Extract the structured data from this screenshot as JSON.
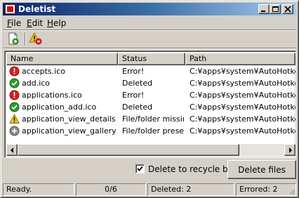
{
  "window": {
    "title": "Deletist",
    "minimize_icon": "minimize-icon",
    "maximize_icon": "maximize-icon",
    "close_icon": "close-icon"
  },
  "menu": [
    {
      "label": "File",
      "accel": "F",
      "rest": "ile"
    },
    {
      "label": "Edit",
      "accel": "E",
      "rest": "dit"
    },
    {
      "label": "Help",
      "accel": "H",
      "rest": "elp"
    }
  ],
  "toolbar": {
    "items": [
      {
        "icon": "new-list-icon"
      },
      {
        "icon": "warning-error-icon"
      }
    ]
  },
  "list": {
    "columns": [
      "Name",
      "Status",
      "Path"
    ],
    "rows": [
      {
        "icon": "error-icon",
        "name": "accepts.ico",
        "status": "Error!",
        "path": "C:¥apps¥system¥AutoHotkey¥S"
      },
      {
        "icon": "success-check-icon",
        "name": "add.ico",
        "status": "Deleted",
        "path": "C:¥apps¥system¥AutoHotkey¥S"
      },
      {
        "icon": "error-icon",
        "name": "applications.ico",
        "status": "Error!",
        "path": "C:¥apps¥system¥AutoHotkey¥S"
      },
      {
        "icon": "success-check-icon",
        "name": "application_add.ico",
        "status": "Deleted",
        "path": "C:¥apps¥system¥AutoHotkey¥S"
      },
      {
        "icon": "warning-icon",
        "name": "application_view_details.ico",
        "status": "File/folder missing",
        "path": "C:¥apps¥system¥AutoHotkey¥S"
      },
      {
        "icon": "pending-plus-icon",
        "name": "application_view_gallery.ico",
        "status": "File/folder present",
        "path": "C:¥apps¥system¥AutoHotkey¥S"
      }
    ]
  },
  "options": {
    "recycle_label": "Delete to recycle bin",
    "recycle_checked": true
  },
  "actions": {
    "delete_label": "Delete files"
  },
  "statusbar": {
    "state": "Ready.",
    "progress": "0/6",
    "deleted": "Deleted: 2",
    "errored": "Errored: 2"
  },
  "colors": {
    "error": "#d42020",
    "success": "#2f9a2f",
    "warning": "#f0c020",
    "pending": "#8a8a8a"
  }
}
